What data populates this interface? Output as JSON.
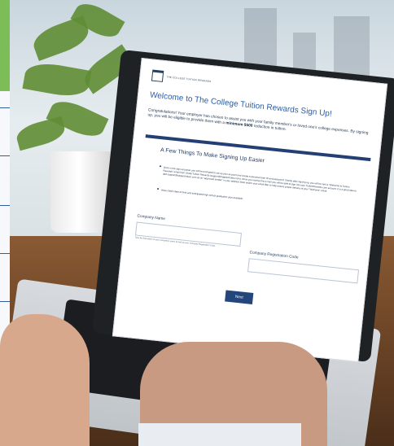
{
  "brand": {
    "logo_text": "THE COLLEGE TUITION REWARDS"
  },
  "page": {
    "title": "Welcome to The College Tuition Rewards Sign Up!",
    "intro_before": "Congratulations! Your employer has chosen to assist you with your family member's or loved one's college expenses. By signing up, you will be eligible to provide them with a ",
    "intro_bold": "minimum $500",
    "intro_after": " reduction in tuition.",
    "section_title": "A Few Things To Make Signing Up Easier",
    "bullets": [
      "Once in the sign up portal, you will be prompted to set up your account and create a personal User ID and password. Shortly after signing up, you will be sent a \"Welcome to Tuition Rewards\" email from SAGE Tuition Rewards (support@sagescholars.com). Once you receive this e-mail you will be able to sign into your TuitionRewards.com account. It is a good idea to add support@sagescholars.com as an \"approved sender\" in your address book and/or your email filter to help ensure proper delivery of your \"Welcome\" email.",
      "Have child's date of birth and anticipated high school graduation year available."
    ]
  },
  "form": {
    "company_name_label": "Company Name",
    "company_name_help": "Type the first letters of your company's name to look up your Company Registration Code.",
    "registration_code_label": "Company Registration Code",
    "next_label": "Next"
  },
  "colors": {
    "accent_blue": "#2e5fa7",
    "navy": "#233f73",
    "green": "#7dbd57"
  }
}
